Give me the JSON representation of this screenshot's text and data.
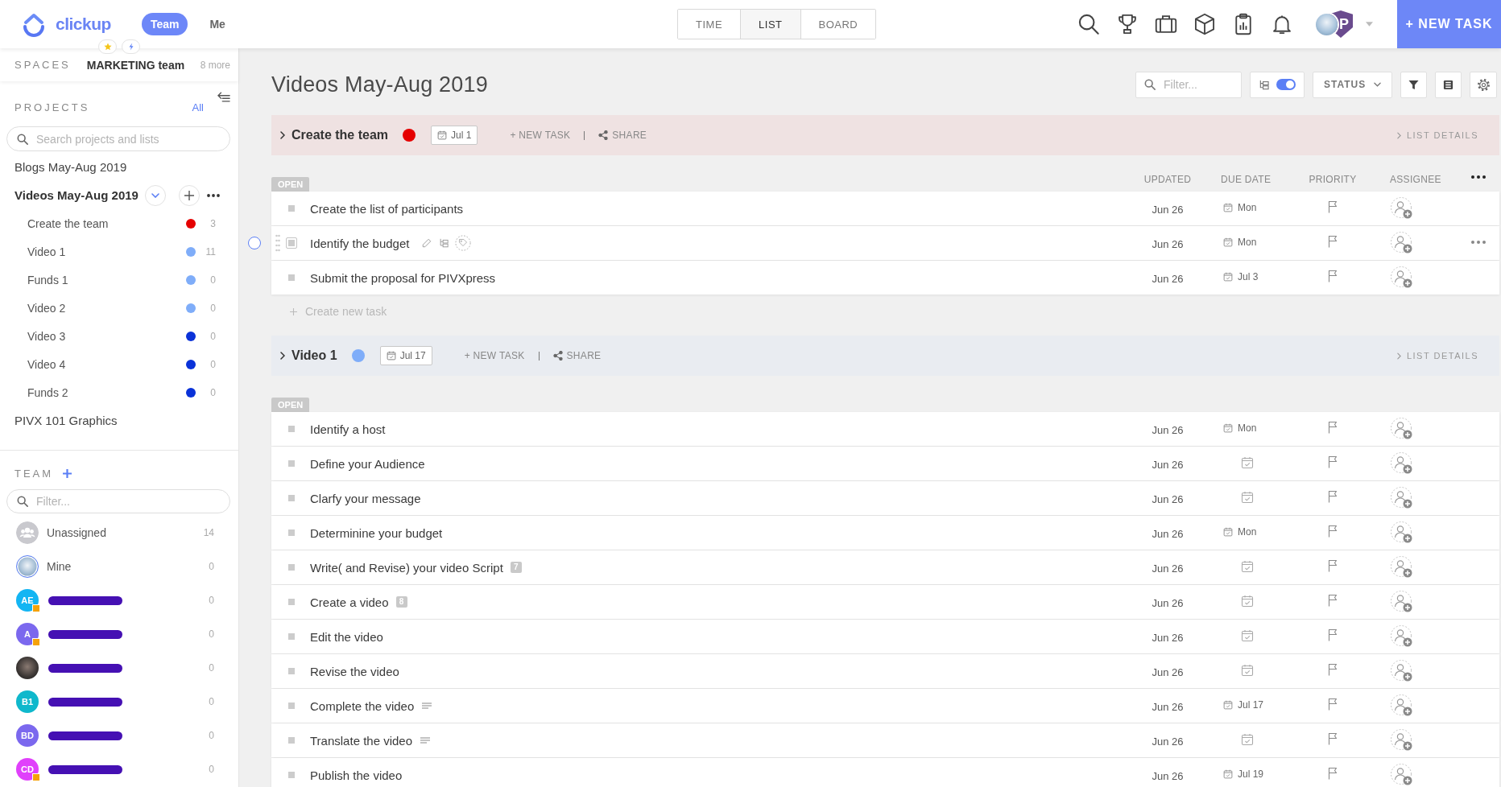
{
  "topbar": {
    "logo_text": "clickup",
    "scope_switch": [
      {
        "label": "Team",
        "selected": true
      },
      {
        "label": "Me",
        "selected": false
      }
    ],
    "view_tabs": [
      {
        "label": "TIME",
        "selected": false
      },
      {
        "label": "LIST",
        "selected": true
      },
      {
        "label": "BOARD",
        "selected": false
      }
    ],
    "workspace_badge": "P",
    "new_task_button": "+ NEW TASK"
  },
  "sidebar": {
    "spaces_label": "SPACES",
    "space_name": "MARKETING team",
    "more_link": "8 more",
    "projects_label": "PROJECTS",
    "projects_filter": "All",
    "search": {
      "placeholder": "Search projects and lists"
    },
    "projects": [
      {
        "name": "Blogs May-Aug 2019",
        "selected": false,
        "expanded": false
      },
      {
        "name": "Videos May-Aug 2019",
        "selected": true,
        "expanded": true,
        "lists": [
          {
            "name": "Create the team",
            "color": "#e50000",
            "count": "3"
          },
          {
            "name": "Video 1",
            "color": "#7fadf9",
            "count": "11"
          },
          {
            "name": "Funds 1",
            "color": "#7fadf9",
            "count": "0"
          },
          {
            "name": "Video 2",
            "color": "#7fadf9",
            "count": "0"
          },
          {
            "name": "Video 3",
            "color": "#0a32d8",
            "count": "0"
          },
          {
            "name": "Video 4",
            "color": "#0a32d8",
            "count": "0"
          },
          {
            "name": "Funds 2",
            "color": "#0a32d8",
            "count": "0"
          }
        ]
      },
      {
        "name": "PIVX 101 Graphics",
        "selected": false,
        "expanded": false
      }
    ],
    "team_label": "TEAM",
    "team_filter": {
      "placeholder": "Filter..."
    },
    "members": [
      {
        "kind": "group",
        "name": "Unassigned",
        "count": "14",
        "highlighted": false,
        "status_badge": false,
        "name_hidden": false
      },
      {
        "kind": "photo",
        "name": "Mine",
        "count": "0",
        "highlighted": true,
        "status_badge": false,
        "name_hidden": false
      },
      {
        "kind": "initials",
        "initials": "AE",
        "color": "#13b5f3",
        "count": "0",
        "highlighted": false,
        "status_badge": true,
        "name_hidden": true
      },
      {
        "kind": "initials",
        "initials": "A",
        "color": "#7b68ee",
        "count": "0",
        "highlighted": false,
        "status_badge": true,
        "name_hidden": true
      },
      {
        "kind": "photo",
        "count": "0",
        "highlighted": false,
        "status_badge": false,
        "name_hidden": true
      },
      {
        "kind": "initials",
        "initials": "B1",
        "color": "#0fb8cc",
        "count": "0",
        "highlighted": false,
        "status_badge": false,
        "name_hidden": true
      },
      {
        "kind": "initials",
        "initials": "BD",
        "color": "#7b68ee",
        "count": "0",
        "highlighted": false,
        "status_badge": false,
        "name_hidden": true
      },
      {
        "kind": "initials",
        "initials": "CD",
        "color": "#e040fb",
        "count": "0",
        "highlighted": false,
        "status_badge": true,
        "name_hidden": true
      }
    ]
  },
  "main": {
    "title": "Videos May-Aug 2019",
    "filter": {
      "placeholder": "Filter..."
    },
    "subtasks_toggle": {
      "on": true
    },
    "status_dropdown": "STATUS",
    "groups": [
      {
        "name": "Create the team",
        "color": "#e50000",
        "date": "Jul 1",
        "new_task": "+ NEW TASK",
        "share": "SHARE",
        "details": "LIST DETAILS",
        "status_label": "OPEN",
        "columns": [
          "UPDATED",
          "DUE DATE",
          "PRIORITY",
          "ASSIGNEE"
        ],
        "tasks": [
          {
            "name": "Create the list of participants",
            "updated": "Jun 26",
            "due": "Mon",
            "hovered": false,
            "has_description": false
          },
          {
            "name": "Identify the budget",
            "updated": "Jun 26",
            "due": "Mon",
            "hovered": true,
            "has_description": false
          },
          {
            "name": "Submit the proposal for PIVXpress",
            "updated": "Jun 26",
            "due": "Jul 3",
            "hovered": false,
            "has_description": false
          }
        ],
        "create_task": "Create new task"
      },
      {
        "name": "Video 1",
        "color": "#7fadf9",
        "date": "Jul 17",
        "new_task": "+ NEW TASK",
        "share": "SHARE",
        "details": "LIST DETAILS",
        "status_label": "OPEN",
        "tasks": [
          {
            "name": "Identify a host",
            "updated": "Jun 26",
            "due": "Mon",
            "hovered": false,
            "has_description": false
          },
          {
            "name": "Define your Audience",
            "updated": "Jun 26",
            "hovered": false,
            "has_description": false
          },
          {
            "name": "Clarfy your message",
            "updated": "Jun 26",
            "hovered": false,
            "has_description": false
          },
          {
            "name": "Determinine your budget",
            "updated": "Jun 26",
            "due": "Mon",
            "hovered": false,
            "has_description": false
          },
          {
            "name": "Write( and Revise) your video Script",
            "badge": "7",
            "updated": "Jun 26",
            "hovered": false,
            "has_description": false
          },
          {
            "name": "Create a video",
            "badge": "8",
            "updated": "Jun 26",
            "hovered": false,
            "has_description": false
          },
          {
            "name": "Edit the video",
            "updated": "Jun 26",
            "hovered": false,
            "has_description": false
          },
          {
            "name": "Revise the video",
            "updated": "Jun 26",
            "hovered": false,
            "has_description": false
          },
          {
            "name": "Complete the video",
            "updated": "Jun 26",
            "due": "Jul 17",
            "hovered": false,
            "has_description": true
          },
          {
            "name": "Translate the video",
            "updated": "Jun 26",
            "hovered": false,
            "has_description": true
          },
          {
            "name": "Publish the video",
            "updated": "Jun 26",
            "due": "Jul 19",
            "hovered": false,
            "has_description": false
          }
        ]
      }
    ]
  }
}
